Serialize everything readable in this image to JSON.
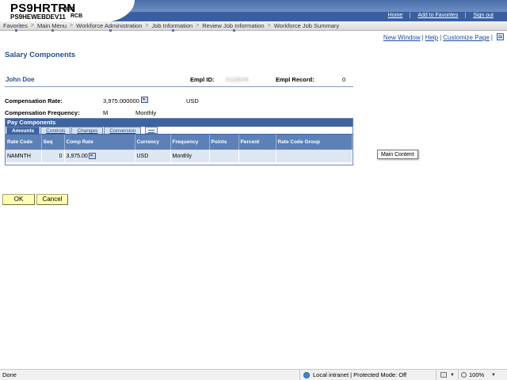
{
  "header": {
    "title": "PS9HRTRN",
    "version": "8.50",
    "db": "PS9HEWEBDEV11",
    "site": "RCB",
    "links": [
      "Home",
      "Add to Favorites",
      "Sign out"
    ]
  },
  "nav": {
    "items": [
      "Favorites",
      "Main Menu",
      "Workforce Administration",
      "Job Information",
      "Review Job Information",
      "Workforce Job Summary"
    ],
    "separator": ">"
  },
  "page_links": {
    "new_window": "New Window",
    "help": "Help",
    "customize": "Customize Page",
    "separator": "|"
  },
  "page_title": "Salary Components",
  "employee": {
    "name": "John Doe",
    "empl_id_label": "Empl ID:",
    "empl_id_value": "0110076",
    "empl_record_label": "Empl Record:",
    "empl_record_value": "0"
  },
  "compensation": {
    "rate_label": "Compensation Rate:",
    "rate_value": "3,975.000000",
    "currency": "USD",
    "frequency_label": "Compensation Frequency:",
    "frequency_code": "M",
    "frequency_desc": "Monthly"
  },
  "grid": {
    "title": "Pay Components",
    "tabs": [
      "Amounts",
      "Controls",
      "Changes",
      "Conversion"
    ],
    "active_tab": "Amounts",
    "columns": [
      "Rate Code",
      "Seq",
      "Comp Rate",
      "Currency",
      "Frequency",
      "Points",
      "Percent",
      "Rate Code Group"
    ],
    "rows": [
      [
        "NAMNTH",
        "0",
        "3,975.00",
        "USD",
        "Monthly",
        "",
        "",
        ""
      ]
    ]
  },
  "tooltip": "Main Content",
  "buttons": {
    "ok": "OK",
    "cancel": "Cancel"
  },
  "status_bar": {
    "state": "Done",
    "zone": "Local intranet | Protected Mode: Off",
    "zoom": "100%"
  },
  "colors": {
    "header_blue": "#3a5fa0",
    "link_blue": "#1a4b9c",
    "grid_header": "#5d80b7",
    "button_yellow": "#ffffb3"
  }
}
